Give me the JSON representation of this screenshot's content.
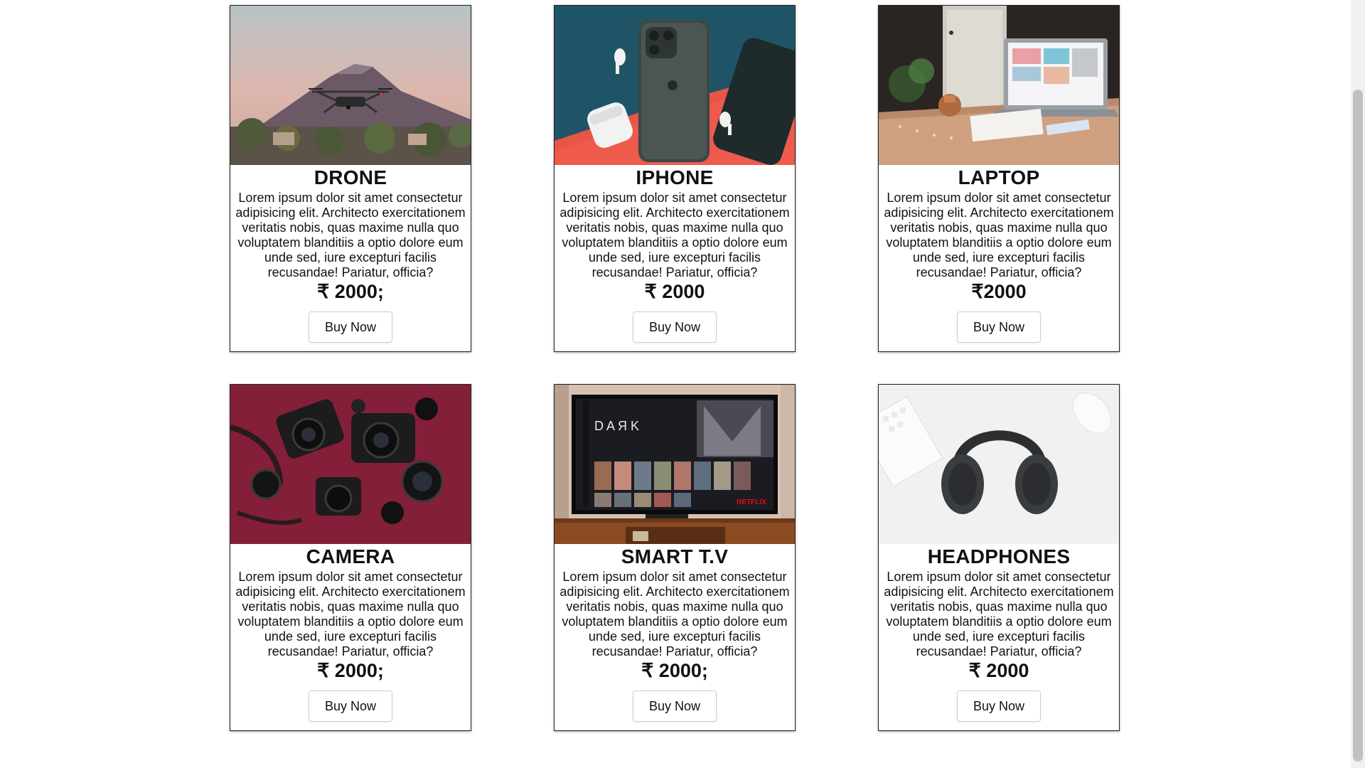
{
  "products": [
    {
      "title": "DRONE",
      "description": "Lorem ipsum dolor sit amet consectetur adipisicing elit. Architecto exercitationem veritatis nobis, quas maxime nulla quo voluptatem blanditiis a optio dolore eum unde sed, iure excepturi facilis recusandae! Pariatur, officia?",
      "price": "₹ 2000;",
      "button_label": "Buy Now",
      "image": "drone-photo"
    },
    {
      "title": "IPHONE",
      "description": "Lorem ipsum dolor sit amet consectetur adipisicing elit. Architecto exercitationem veritatis nobis, quas maxime nulla quo voluptatem blanditiis a optio dolore eum unde sed, iure excepturi facilis recusandae! Pariatur, officia?",
      "price": "₹ 2000",
      "button_label": "Buy Now",
      "image": "iphone-photo"
    },
    {
      "title": "LAPTOP",
      "description": "Lorem ipsum dolor sit amet consectetur adipisicing elit. Architecto exercitationem veritatis nobis, quas maxime nulla quo voluptatem blanditiis a optio dolore eum unde sed, iure excepturi facilis recusandae! Pariatur, officia?",
      "price": "₹2000",
      "button_label": "Buy Now",
      "image": "laptop-photo"
    },
    {
      "title": "CAMERA",
      "description": "Lorem ipsum dolor sit amet consectetur adipisicing elit. Architecto exercitationem veritatis nobis, quas maxime nulla quo voluptatem blanditiis a optio dolore eum unde sed, iure excepturi facilis recusandae! Pariatur, officia?",
      "price": "₹ 2000;",
      "button_label": "Buy Now",
      "image": "camera-photo"
    },
    {
      "title": "SMART T.V",
      "description": "Lorem ipsum dolor sit amet consectetur adipisicing elit. Architecto exercitationem veritatis nobis, quas maxime nulla quo voluptatem blanditiis a optio dolore eum unde sed, iure excepturi facilis recusandae! Pariatur, officia?",
      "price": "₹ 2000;",
      "button_label": "Buy Now",
      "image": "tv-photo"
    },
    {
      "title": "HEADPHONES",
      "description": "Lorem ipsum dolor sit amet consectetur adipisicing elit. Architecto exercitationem veritatis nobis, quas maxime nulla quo voluptatem blanditiis a optio dolore eum unde sed, iure excepturi facilis recusandae! Pariatur, officia?",
      "price": "₹ 2000",
      "button_label": "Buy Now",
      "image": "headphones-photo"
    }
  ],
  "tv_screen": {
    "show_title": "D A Я K",
    "brand": "NETFLIX"
  },
  "colors": {
    "card_border": "#222222",
    "background": "#ffffff",
    "scrollbar_track": "#f1f1f1",
    "scrollbar_thumb": "#c1c1c1"
  }
}
